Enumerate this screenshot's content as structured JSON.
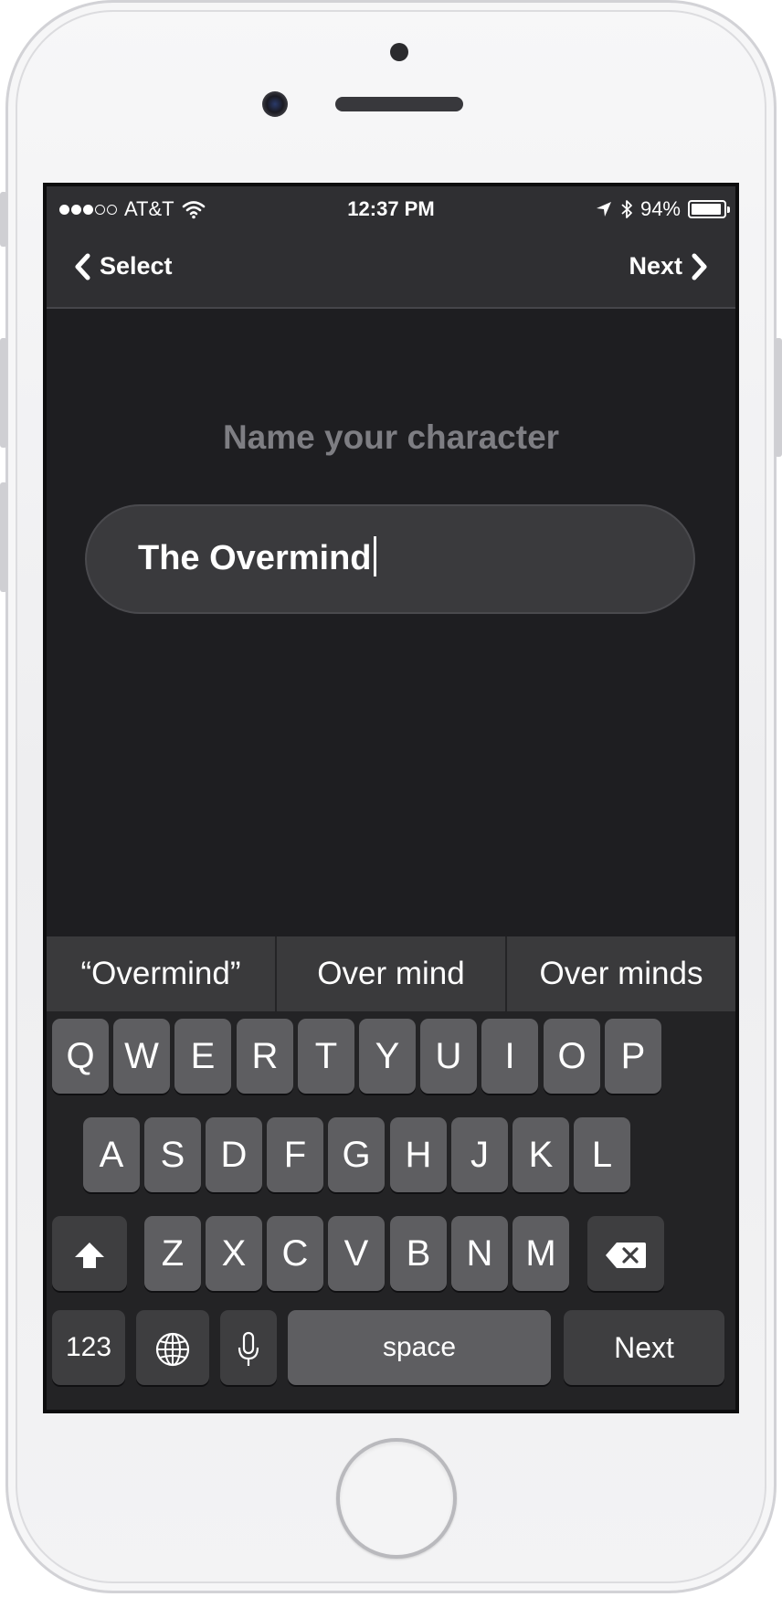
{
  "status_bar": {
    "carrier": "AT&T",
    "time": "12:37 PM",
    "battery": "94%",
    "battery_level": 0.94,
    "signal_bars": 3,
    "icons": [
      "wifi-icon",
      "location-arrow-icon",
      "bluetooth-icon",
      "battery-icon"
    ]
  },
  "nav": {
    "back_label": "Select",
    "next_label": "Next"
  },
  "main": {
    "prompt": "Name your character",
    "name_value": "The Overmind"
  },
  "suggestions": [
    "“Overmind”",
    "Over mind",
    "Over minds"
  ],
  "keyboard": {
    "row1": [
      "Q",
      "W",
      "E",
      "R",
      "T",
      "Y",
      "U",
      "I",
      "O",
      "P"
    ],
    "row2": [
      "A",
      "S",
      "D",
      "F",
      "G",
      "H",
      "J",
      "K",
      "L"
    ],
    "row3": [
      "Z",
      "X",
      "C",
      "V",
      "B",
      "N",
      "M"
    ],
    "numbers_label": "123",
    "space_label": "space",
    "return_label": "Next",
    "icons": [
      "shift-icon",
      "delete-icon",
      "globe-icon",
      "microphone-icon"
    ]
  },
  "colors": {
    "screen_bg": "#1e1e21",
    "bar_bg": "#2f2f32",
    "prompt_text": "#7e7e83",
    "field_bg": "#3a3a3d",
    "key_bg": "#5e5e61",
    "key_dark_bg": "#3e3e40"
  }
}
